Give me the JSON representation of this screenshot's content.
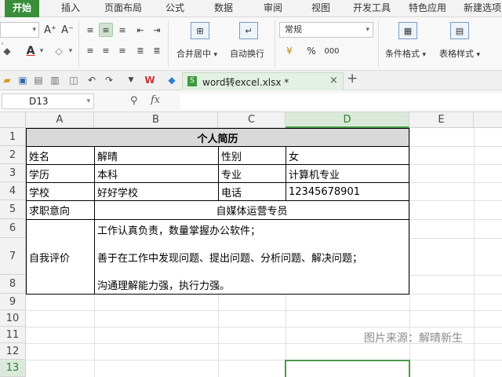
{
  "menu": {
    "tabs": [
      "开始",
      "插入",
      "页面布局",
      "公式",
      "数据",
      "审阅",
      "视图",
      "开发工具",
      "特色应用",
      "新建选项"
    ]
  },
  "ribbon": {
    "font_size_hint": "",
    "font_grow": "A⁺",
    "font_shrink": "A⁻",
    "merge_center": "合并居中",
    "wrap_text": "自动换行",
    "number_format": "常规",
    "percent": "%",
    "thousands": "000",
    "cond_format": "条件格式",
    "table_style": "表格样式"
  },
  "document": {
    "tab_title": "word转excel.xlsx *",
    "close": "×",
    "new_tab": "+"
  },
  "formula_bar": {
    "cell_ref": "D13",
    "fx": "fx",
    "content": ""
  },
  "sheet": {
    "columns": [
      "A",
      "B",
      "C",
      "D",
      "E"
    ],
    "selected_column": "D",
    "rows": [
      "1",
      "2",
      "3",
      "4",
      "5",
      "6",
      "7",
      "8",
      "9",
      "10",
      "11",
      "12",
      "13"
    ],
    "selected_row": "13",
    "title": "个人简历",
    "name_label": "姓名",
    "name_value": "解晴",
    "gender_label": "性别",
    "gender_value": "女",
    "edu_label": "学历",
    "edu_value": "本科",
    "major_label": "专业",
    "major_value": "计算机专业",
    "school_label": "学校",
    "school_value": "好好学校",
    "phone_label": "电话",
    "phone_value": "12345678901",
    "intent_label": "求职意向",
    "intent_value": "自媒体运营专员",
    "eval_label": "自我评价",
    "eval_line1": "工作认真负责，数量掌握办公软件；",
    "eval_line2": "善于在工作中发现问题、提出问题、分析问题、解决问题；",
    "eval_line3": "沟通理解能力强，执行力强。",
    "watermark": "图片来源：解晴新生"
  }
}
